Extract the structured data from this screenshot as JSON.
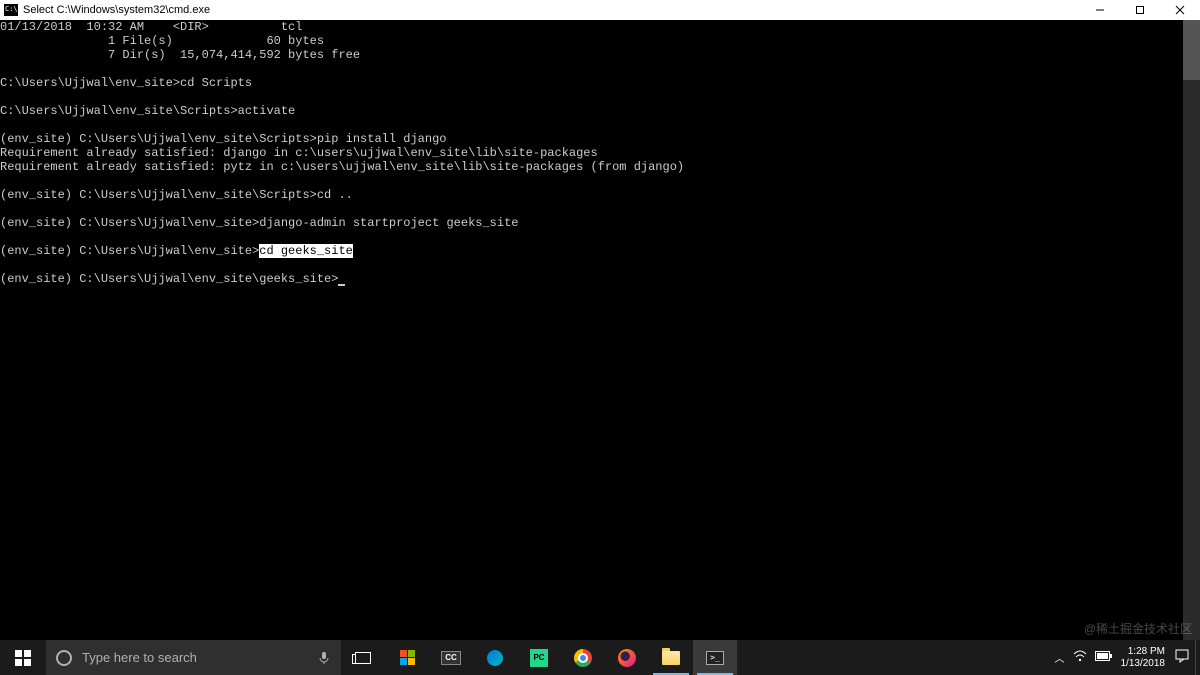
{
  "titlebar": {
    "title": "Select C:\\Windows\\system32\\cmd.exe"
  },
  "terminal": {
    "lines": [
      "01/13/2018  10:32 AM    <DIR>          tcl",
      "               1 File(s)             60 bytes",
      "               7 Dir(s)  15,074,414,592 bytes free",
      "",
      "C:\\Users\\Ujjwal\\env_site>cd Scripts",
      "",
      "C:\\Users\\Ujjwal\\env_site\\Scripts>activate",
      "",
      "(env_site) C:\\Users\\Ujjwal\\env_site\\Scripts>pip install django",
      "Requirement already satisfied: django in c:\\users\\ujjwal\\env_site\\lib\\site-packages",
      "Requirement already satisfied: pytz in c:\\users\\ujjwal\\env_site\\lib\\site-packages (from django)",
      "",
      "(env_site) C:\\Users\\Ujjwal\\env_site\\Scripts>cd ..",
      "",
      "(env_site) C:\\Users\\Ujjwal\\env_site>django-admin startproject geeks_site",
      ""
    ],
    "highlight_line_prefix": "(env_site) C:\\Users\\Ujjwal\\env_site>",
    "highlight_text": "cd geeks_site",
    "cursor_line": "(env_site) C:\\Users\\Ujjwal\\env_site\\geeks_site>"
  },
  "watermark": "@稀土掘金技术社区",
  "taskbar": {
    "search_placeholder": "Type here to search",
    "clock_time": "1:28 PM",
    "clock_date": "1/13/2018",
    "cc": "CC",
    "pc": "PC",
    "term": ">_"
  },
  "tray": {
    "chevron": "︿"
  }
}
